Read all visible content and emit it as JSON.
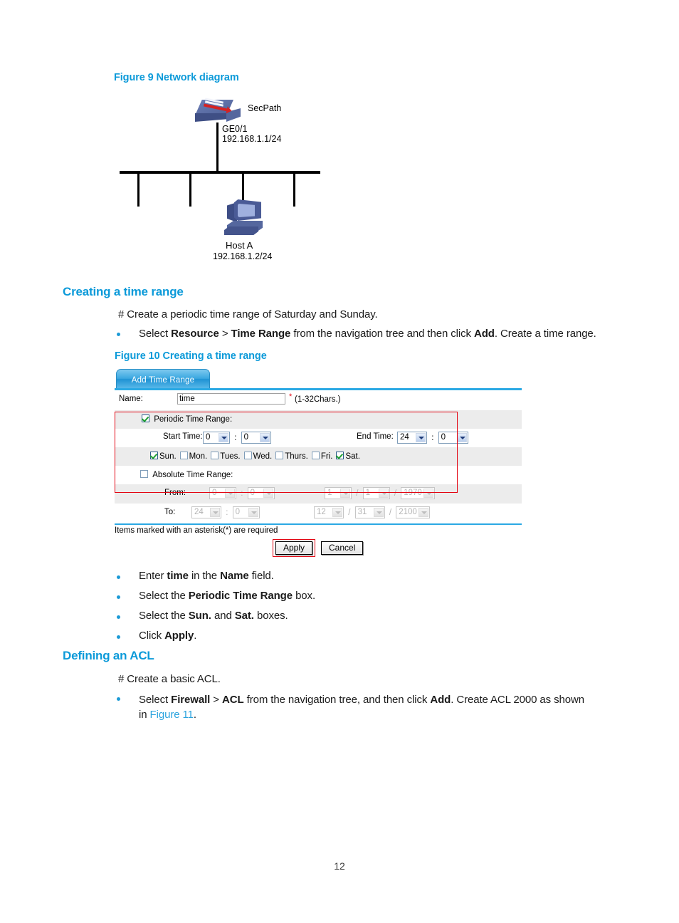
{
  "page": {
    "number": "12"
  },
  "figure9": {
    "caption": "Figure 9 Network diagram",
    "device_label": "SecPath",
    "interface_label": "GE0/1",
    "interface_ip": "192.168.1.1/24",
    "host_label": "Host A",
    "host_ip": "192.168.1.2/24"
  },
  "section_time_range": {
    "heading": "Creating a time range",
    "comment": "# Create a periodic time range of Saturday and Sunday.",
    "bullet1": {
      "a": "Select ",
      "b1": "Resource",
      "c": " > ",
      "b2": "Time Range",
      "d": " from the navigation tree and then click ",
      "b3": "Add",
      "e": ". Create a time range."
    }
  },
  "figure10": {
    "caption": "Figure 10 Creating a time range"
  },
  "dialog": {
    "tab_label": "Add Time Range",
    "name_label": "Name:",
    "name_value": "time",
    "name_hint": "(1-32Chars.)",
    "asterisk": "*",
    "periodic_label": "Periodic Time Range:",
    "periodic_checked": true,
    "start_time_label": "Start Time:",
    "start_hour": "0",
    "start_minute": "0",
    "end_time_label": "End Time:",
    "end_hour": "24",
    "end_minute": "0",
    "weekdays": [
      {
        "label": "Sun.",
        "checked": true
      },
      {
        "label": "Mon.",
        "checked": false
      },
      {
        "label": "Tues.",
        "checked": false
      },
      {
        "label": "Wed.",
        "checked": false
      },
      {
        "label": "Thurs.",
        "checked": false
      },
      {
        "label": "Fri.",
        "checked": false
      },
      {
        "label": "Sat.",
        "checked": true
      }
    ],
    "absolute_label": "Absolute Time Range:",
    "absolute_checked": false,
    "from_label": "From:",
    "from_hour": "0",
    "from_minute": "0",
    "from_month": "1",
    "from_day": "1",
    "from_year": "1970",
    "to_label": "To:",
    "to_hour": "24",
    "to_minute": "0",
    "to_month": "12",
    "to_day": "31",
    "to_year": "2100",
    "required_note": "Items marked with an asterisk(*) are required",
    "apply_label": "Apply",
    "cancel_label": "Cancel",
    "time_sep": ":",
    "date_sep": "/"
  },
  "steps": {
    "s1": {
      "a": "Enter ",
      "b": "time",
      "c": " in the ",
      "b2": "Name",
      "d": " field."
    },
    "s2": {
      "a": "Select the ",
      "b": "Periodic Time Range",
      "c": " box."
    },
    "s3": {
      "a": "Select the ",
      "b": "Sun.",
      "c": " and ",
      "b2": "Sat.",
      "d": " boxes."
    },
    "s4": {
      "a": "Click ",
      "b": "Apply",
      "c": "."
    }
  },
  "section_acl": {
    "heading": "Defining an ACL",
    "comment": "# Create a basic ACL.",
    "bullet1": {
      "a": "Select ",
      "b1": "Firewall",
      "c": " > ",
      "b2": "ACL",
      "d": " from the navigation tree, and then click ",
      "b3": "Add",
      "e": ". Create ACL 2000 as shown",
      "f": "in ",
      "link": "Figure 11",
      "g": "."
    }
  }
}
